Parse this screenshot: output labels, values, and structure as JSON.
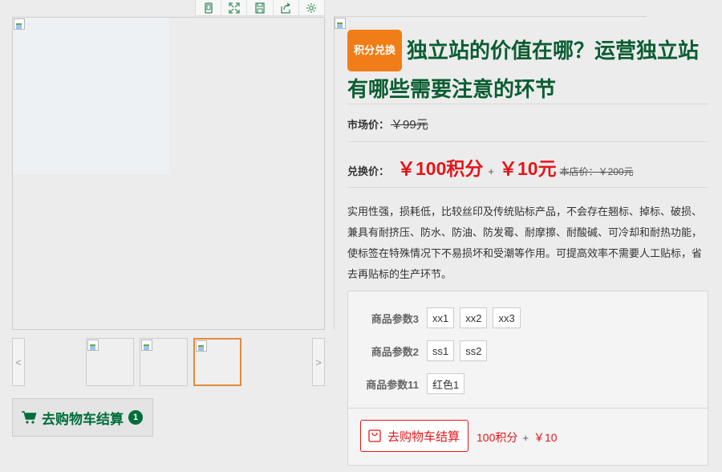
{
  "toolbar": {
    "icons": [
      "phone-icon",
      "fullscreen-icon",
      "save-icon",
      "share-icon",
      "settings-icon"
    ]
  },
  "product": {
    "tag": "积分兑换",
    "title": "独立站的价值在哪？运营独立站有哪些需要注意的环节",
    "market_label": "市场价：",
    "market_price": "￥99元",
    "exchange_label": "兑换价：",
    "exchange_points": "￥100积分",
    "plus": "+",
    "exchange_cash": "￥10元",
    "store_price": "本店价：￥200元",
    "description": "实用性强，损耗低，比较丝印及传统贴标产品，不会存在翘标、掉标、破损、兼具有耐挤压、防水、防油、防发霉、耐摩擦、耐酸碱、可冷却和耐热功能，使标签在特殊情况下不易损坏和受潮等作用。可提高效率不需要人工贴标，省去再贴标的生产环节。"
  },
  "options": [
    {
      "label": "商品参数3",
      "values": [
        "xx1",
        "xx2",
        "xx3"
      ]
    },
    {
      "label": "商品参数2",
      "values": [
        "ss1",
        "ss2"
      ]
    },
    {
      "label": "商品参数11",
      "values": [
        "红色1"
      ]
    }
  ],
  "cart": {
    "left_label": "去购物车结算",
    "count": "1",
    "button_label": "去购物车结算",
    "sum_points": "100积分",
    "sum_plus": "+",
    "sum_cash": "￥10"
  },
  "thumbs": {
    "prev": "<",
    "next": ">",
    "count": 3,
    "active_index": 2
  },
  "colors": {
    "brand_green": "#0a5d32",
    "price_red": "#e4161a",
    "tag_orange": "#f07d17",
    "active_thumb": "#e08a3c"
  }
}
